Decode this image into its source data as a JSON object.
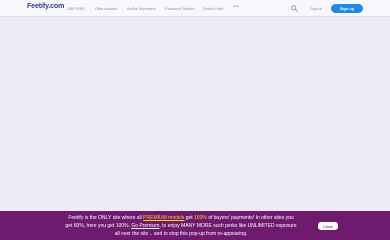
{
  "header": {
    "logo": "Feetify.com",
    "nav": [
      "Gift FREE",
      "Gifts Awards",
      "Active Members",
      "Featured Sellers",
      "Select Paid"
    ],
    "more": "•••",
    "signin": "Sign in",
    "signup": "Sign up"
  },
  "banner": {
    "line1_a": "Feetify is the ONLY site where all ",
    "line1_premium": "PREMIUM models",
    "line1_b": " get ",
    "line1_pct": "100%",
    "line1_c": " of buyers' payments! In other sites you",
    "line2_a": "get 60%, here you get 100%. ",
    "line2_go": "Go Premium",
    "line2_b": ", to enjoy MANY MORE such perks like UNLIMITED exposure",
    "line3": "all over the site .. and to stop this pop-up from re-appearing.",
    "close": "Close"
  },
  "colors": {
    "accent": "#1f8ae8",
    "banner": "#6e1b6f",
    "highlight": "#ffd400",
    "logo": "#2f3a8f"
  }
}
